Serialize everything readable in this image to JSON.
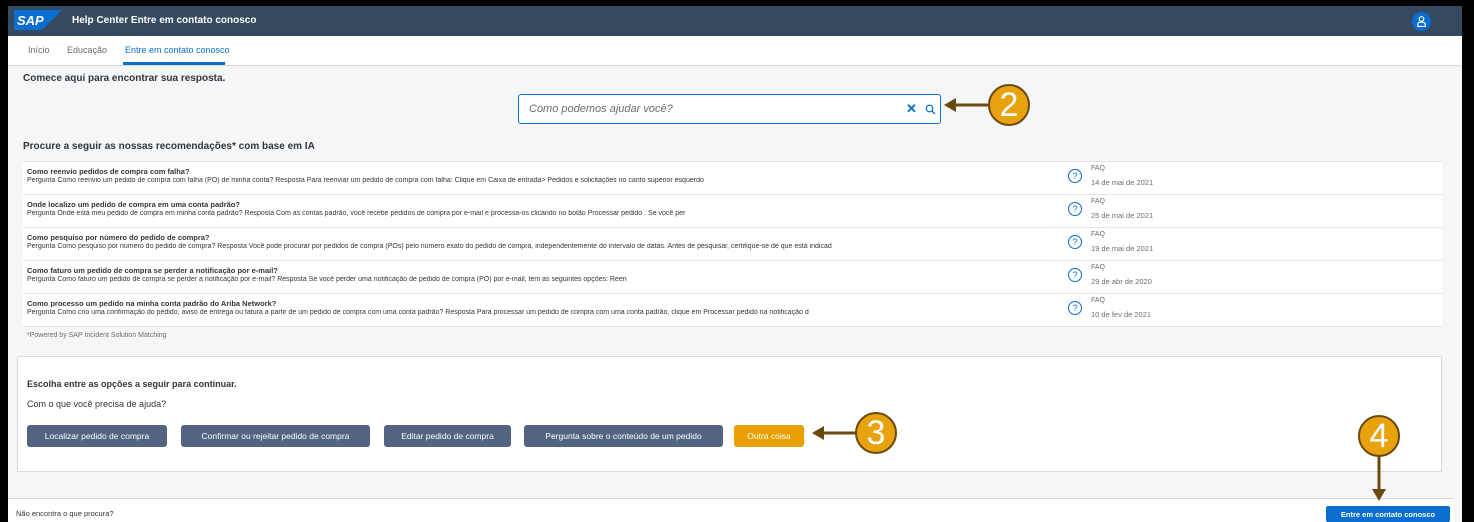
{
  "shell": {
    "logo": "SAP",
    "title": "Help Center Entre em contato conosco"
  },
  "tabs": [
    {
      "label": "Início"
    },
    {
      "label": "Educação"
    },
    {
      "label": "Entre em contato conosco"
    }
  ],
  "main": {
    "headline": "Comece aqui para encontrar sua resposta.",
    "search": {
      "placeholder": "Como podemos ajudar você?",
      "value": ""
    },
    "rec_heading": "Procure a seguir as nossas recomendações* com base em IA",
    "recommendations": [
      {
        "title": "Como reenvio pedidos de compra com falha?",
        "description": "Pergunta Como reenvio um pedido de compra com falha (PO) de minha conta? Resposta Para reenviar um pedido de compra com falha: Clique em Caixa de entrada> Pedidos e solicitações no canto superior esquerdo",
        "type": "FAQ",
        "date": "14 de mai de 2021"
      },
      {
        "title": "Onde localizo um pedido de compra em uma conta padrão?",
        "description": "Pergunta Onde está meu pedido de compra em minha conta padrão? Resposta Com as contas padrão, você recebe pedidos de compra por e-mail e processa-os clicando no botão Processar pedido . Se você per",
        "type": "FAQ",
        "date": "25 de mai de 2021"
      },
      {
        "title": "Como pesquiso por número do pedido de compra?",
        "description": "Pergunta Como pesquiso por número do pedido de compra? Resposta Você pode procurar por pedidos de compra (POs) pelo número exato do pedido de compra, independentemente do intervalo de datas. Antes de pesquisar, certifique-se de que está indicad",
        "type": "FAQ",
        "date": "19 de mai de 2021"
      },
      {
        "title": "Como faturo um pedido de compra se perder a notificação por e-mail?",
        "description": "Pergunta Como faturo um pedido de compra se perder a notificação por e-mail? Resposta Se você perder uma notificação de pedido de compra (PO) por e-mail, tem as seguintes opções: Reen",
        "type": "FAQ",
        "date": "29 de abr de 2020"
      },
      {
        "title": "Como processo um pedido na minha conta padrão do Ariba Network?",
        "description": "Pergunta Como crio uma confirmação do pedido, aviso de entrega ou fatura a partir de um pedido de compra com uma conta padrão? Resposta Para processar um pedido de compra com uma conta padrão, clique em  Processar pedido  na notificação d",
        "type": "FAQ",
        "date": "10 de fev de 2021"
      }
    ],
    "powered_by": "*Powered by SAP Incident Solution Matching"
  },
  "options": {
    "heading": "Escolha entre as opções a seguir para continuar.",
    "question": "Com o que você precisa de ajuda?",
    "buttons": [
      {
        "label": "Localizar pedido de compra"
      },
      {
        "label": "Confirmar ou rejeitar pedido de compra"
      },
      {
        "label": "Editar pedido de compra"
      },
      {
        "label": "Pergunta sobre o conteúdo de um pedido"
      },
      {
        "label": "Outra coisa"
      }
    ]
  },
  "footer": {
    "text": "Não encontra o que procura?",
    "contact_label": "Entre em contato conosco"
  },
  "callouts": [
    "2",
    "3",
    "4"
  ],
  "colors": {
    "shell": "#354a5f",
    "accent": "#0a6ed1",
    "option_button": "#526482",
    "other_button": "#e9a000",
    "callout": "#e8a20e"
  }
}
